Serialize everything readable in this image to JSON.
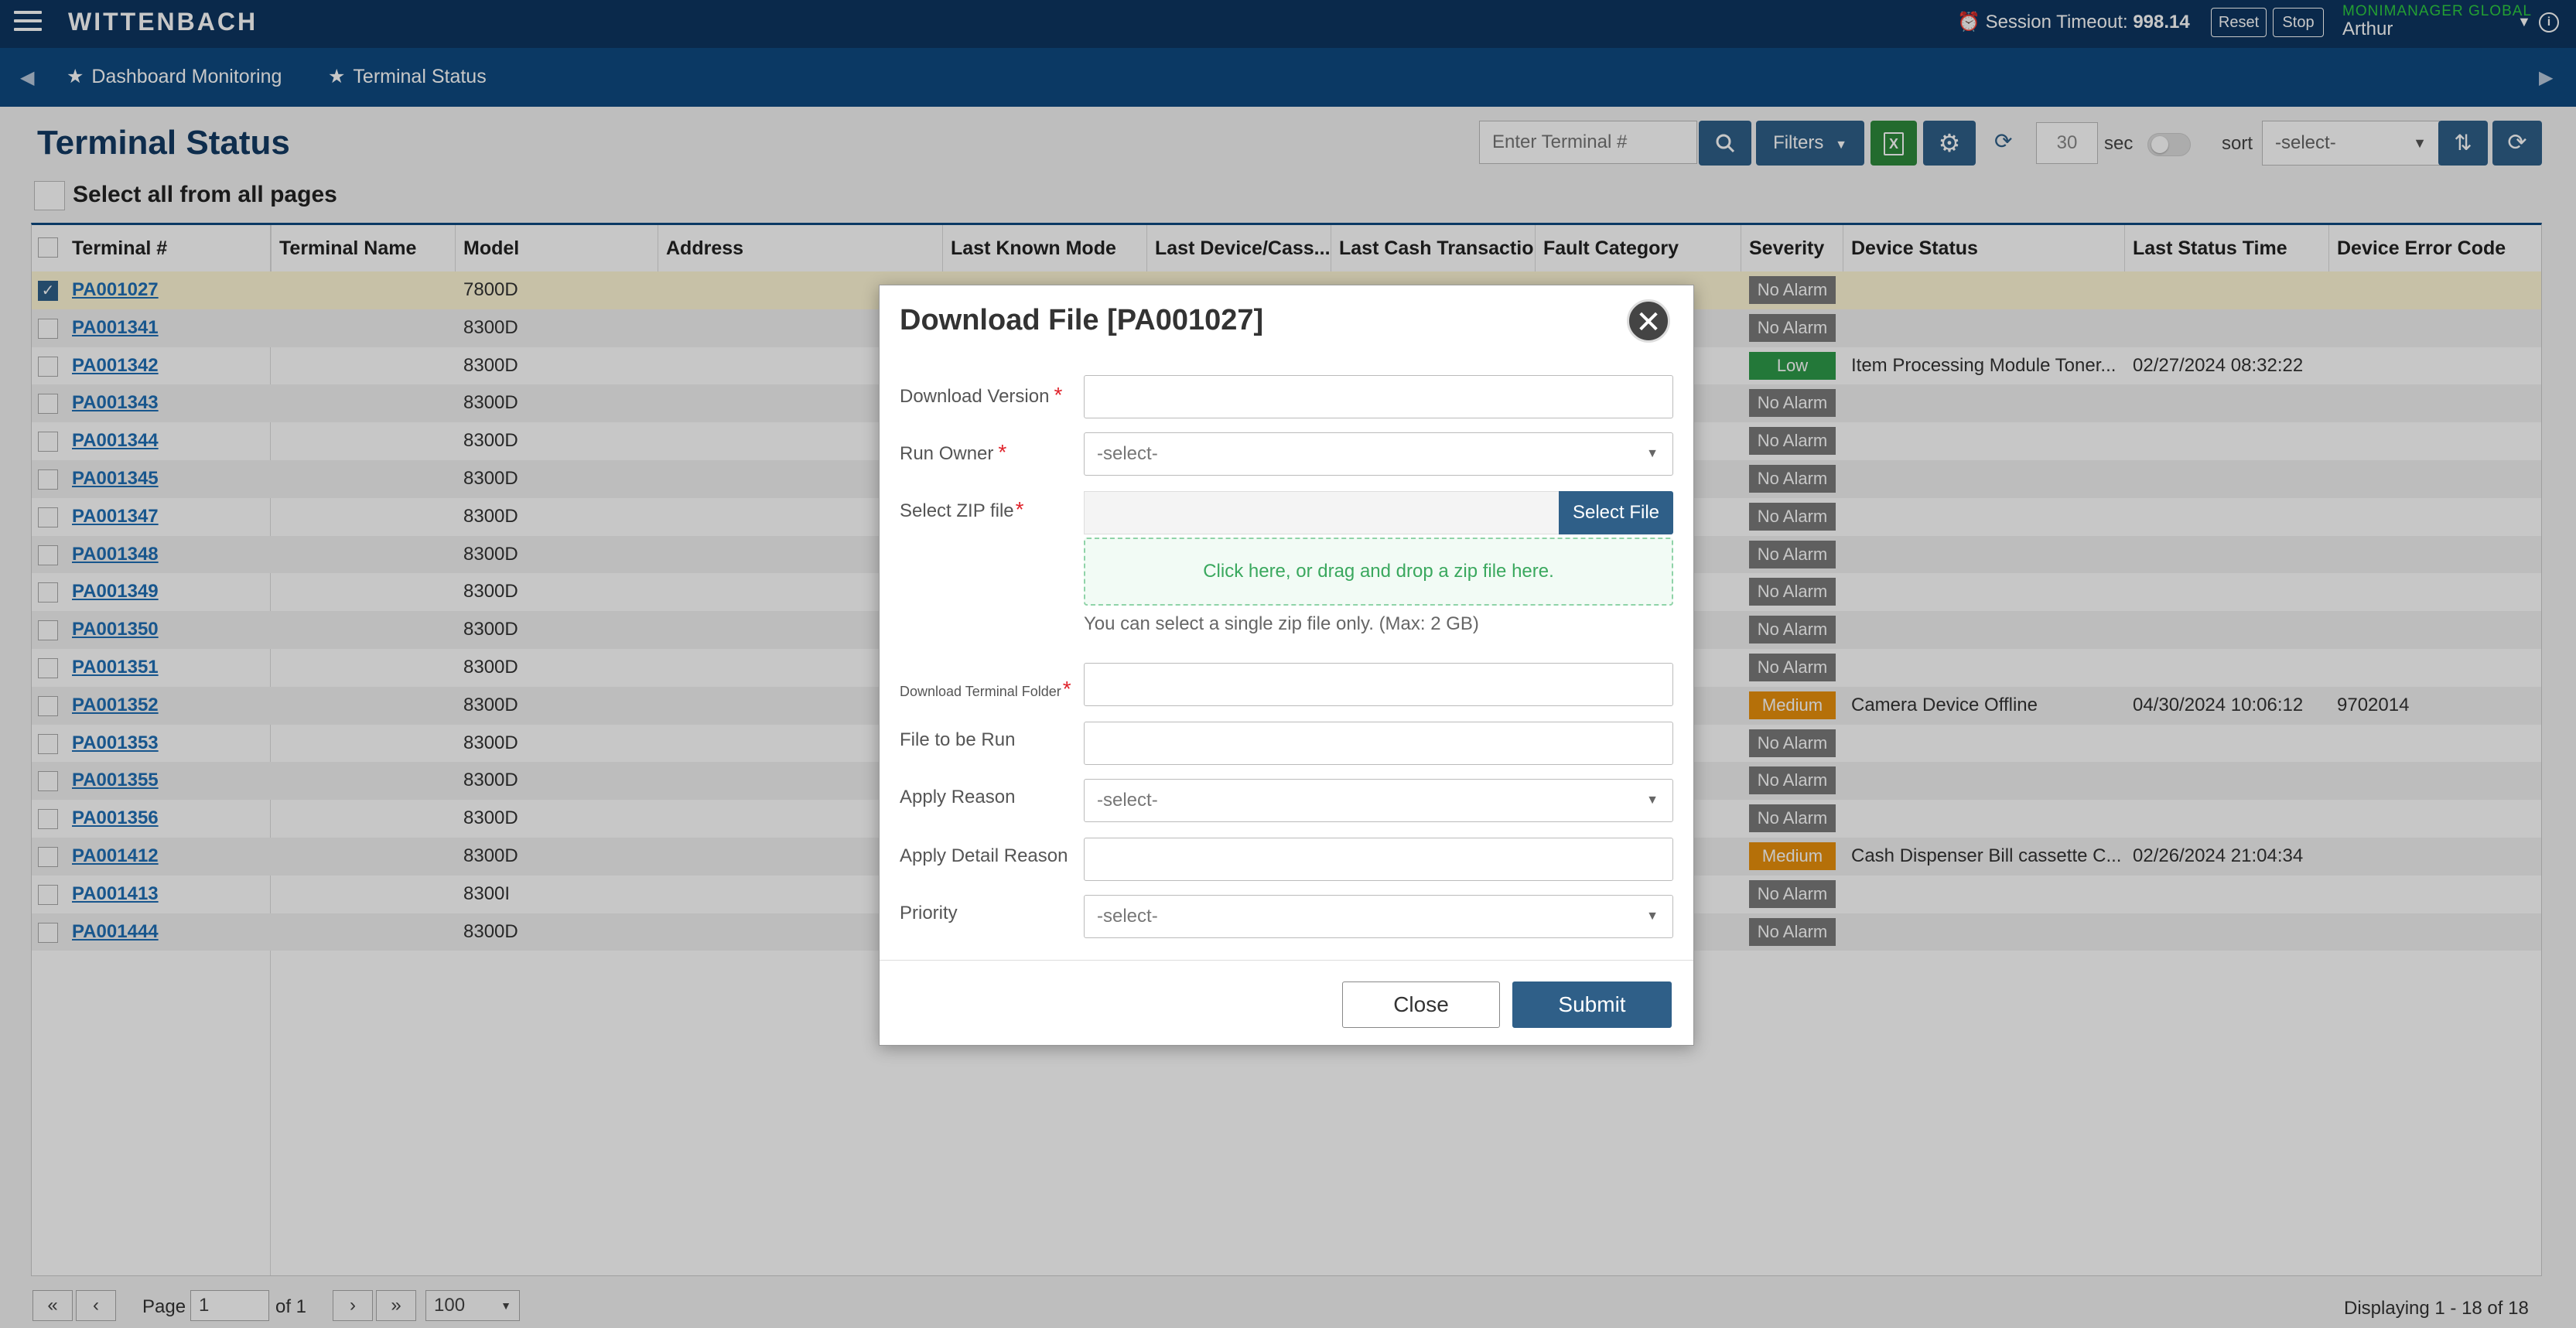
{
  "header": {
    "brand": "WITTENBACH",
    "session_label": "Session Timeout:",
    "session_value": "998.14",
    "reset_label": "Reset",
    "stop_label": "Stop",
    "user_org": "MONIMANAGER GLOBAL",
    "user_name": "Arthur",
    "info_glyph": "i"
  },
  "nav": {
    "items": [
      {
        "label": "Dashboard Monitoring",
        "icon": "star-icon"
      },
      {
        "label": "Terminal Status",
        "icon": "star-icon"
      }
    ]
  },
  "toolbar": {
    "page_title": "Terminal Status",
    "terminal_placeholder": "Enter Terminal #",
    "filters_label": "Filters",
    "refresh_seconds": "30",
    "sec_label": "sec",
    "sort_label": "sort",
    "sort_value": "-select-",
    "select_all_label": "Select all from all pages"
  },
  "table": {
    "columns": [
      "Terminal #",
      "Terminal Name",
      "Model",
      "Address",
      "Last Known Mode",
      "Last Device/Cass...",
      "Last Cash Transaction",
      "Fault Category",
      "Severity",
      "Device Status",
      "Last Status Time",
      "Device Error Code"
    ],
    "rows": [
      {
        "id": "PA001027",
        "model": "7800D",
        "severity": "No Alarm",
        "status": "",
        "time": "",
        "code": "",
        "checked": true
      },
      {
        "id": "PA001341",
        "model": "8300D",
        "severity": "No Alarm",
        "status": "",
        "time": "",
        "code": "",
        "checked": false
      },
      {
        "id": "PA001342",
        "model": "8300D",
        "severity": "Low",
        "status": "Item Processing Module Toner...",
        "time": "02/27/2024 08:32:22",
        "code": "",
        "checked": false
      },
      {
        "id": "PA001343",
        "model": "8300D",
        "severity": "No Alarm",
        "status": "",
        "time": "",
        "code": "",
        "checked": false
      },
      {
        "id": "PA001344",
        "model": "8300D",
        "severity": "No Alarm",
        "status": "",
        "time": "",
        "code": "",
        "checked": false
      },
      {
        "id": "PA001345",
        "model": "8300D",
        "severity": "No Alarm",
        "status": "",
        "time": "",
        "code": "",
        "checked": false
      },
      {
        "id": "PA001347",
        "model": "8300D",
        "severity": "No Alarm",
        "status": "",
        "time": "",
        "code": "",
        "checked": false
      },
      {
        "id": "PA001348",
        "model": "8300D",
        "severity": "No Alarm",
        "status": "",
        "time": "",
        "code": "",
        "checked": false
      },
      {
        "id": "PA001349",
        "model": "8300D",
        "severity": "No Alarm",
        "status": "",
        "time": "",
        "code": "",
        "checked": false
      },
      {
        "id": "PA001350",
        "model": "8300D",
        "severity": "No Alarm",
        "status": "",
        "time": "",
        "code": "",
        "checked": false
      },
      {
        "id": "PA001351",
        "model": "8300D",
        "severity": "No Alarm",
        "status": "",
        "time": "",
        "code": "",
        "checked": false
      },
      {
        "id": "PA001352",
        "model": "8300D",
        "severity": "Medium",
        "status": "Camera Device Offline",
        "time": "04/30/2024 10:06:12",
        "code": "9702014",
        "checked": false
      },
      {
        "id": "PA001353",
        "model": "8300D",
        "severity": "No Alarm",
        "status": "",
        "time": "",
        "code": "",
        "checked": false
      },
      {
        "id": "PA001355",
        "model": "8300D",
        "severity": "No Alarm",
        "status": "",
        "time": "",
        "code": "",
        "checked": false
      },
      {
        "id": "PA001356",
        "model": "8300D",
        "severity": "No Alarm",
        "status": "",
        "time": "",
        "code": "",
        "checked": false
      },
      {
        "id": "PA001412",
        "model": "8300D",
        "severity": "Medium",
        "status": "Cash Dispenser Bill cassette C...",
        "time": "02/26/2024 21:04:34",
        "code": "",
        "checked": false
      },
      {
        "id": "PA001413",
        "model": "8300I",
        "severity": "No Alarm",
        "status": "",
        "time": "",
        "code": "",
        "checked": false
      },
      {
        "id": "PA001444",
        "model": "8300D",
        "severity": "No Alarm",
        "status": "",
        "time": "",
        "code": "",
        "checked": false
      }
    ],
    "severity_colors": {
      "No Alarm": "#7a7a7a",
      "Low": "#2e9a4a",
      "Medium": "#e8900c"
    }
  },
  "footer": {
    "first": "«",
    "prev": "‹",
    "page_label": "Page",
    "page_value": "1",
    "of_label": "of 1",
    "next": "›",
    "last": "»",
    "page_size": "100",
    "displaying": "Displaying 1 - 18 of 18"
  },
  "modal": {
    "title": "Download File [PA001027]",
    "close_glyph": "✕",
    "download_version_label": "Download Version",
    "run_owner_label": "Run Owner",
    "run_owner_value": "-select-",
    "select_zip_label": "Select ZIP file",
    "select_file_button": "Select File",
    "dropzone_text": "Click here, or drag and drop a zip file here.",
    "zip_hint": "You can select a single zip file only. (Max: 2 GB)",
    "terminal_folder_label": "Download Terminal Folder",
    "file_to_run_label": "File to be Run",
    "apply_reason_label": "Apply Reason",
    "apply_reason_value": "-select-",
    "apply_detail_label": "Apply Detail Reason",
    "priority_label": "Priority",
    "priority_value": "-select-",
    "close_button": "Close",
    "submit_button": "Submit",
    "required_mark": "*"
  }
}
